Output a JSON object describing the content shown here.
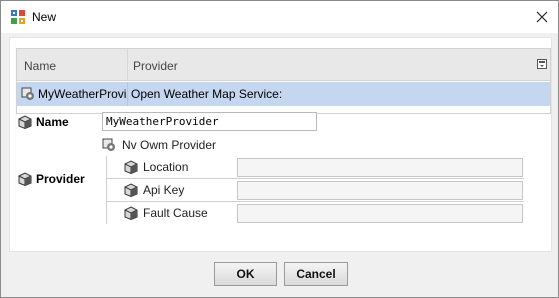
{
  "window": {
    "title": "New",
    "icons": {
      "app": "app-grid-icon",
      "close": "close-icon"
    }
  },
  "table": {
    "columns": [
      "Name",
      "Provider"
    ],
    "rows": [
      {
        "name": "MyWeatherProvider",
        "provider": "Open Weather Map Service:"
      }
    ],
    "menu_icon": "column-chooser-icon"
  },
  "properties": {
    "name_label": "Name",
    "name_value": "MyWeatherProvider",
    "provider_label": "Provider",
    "provider_type": "Nv Owm Provider",
    "fields": [
      {
        "label": "Location",
        "value": ""
      },
      {
        "label": "Api Key",
        "value": ""
      },
      {
        "label": "Fault Cause",
        "value": ""
      }
    ],
    "icons": {
      "property": "property-cube-icon",
      "provider": "component-gear-icon"
    }
  },
  "buttons": {
    "ok": "OK",
    "cancel": "Cancel"
  },
  "colors": {
    "selection": "#c5d6f0",
    "header": "#e8e8e8"
  }
}
